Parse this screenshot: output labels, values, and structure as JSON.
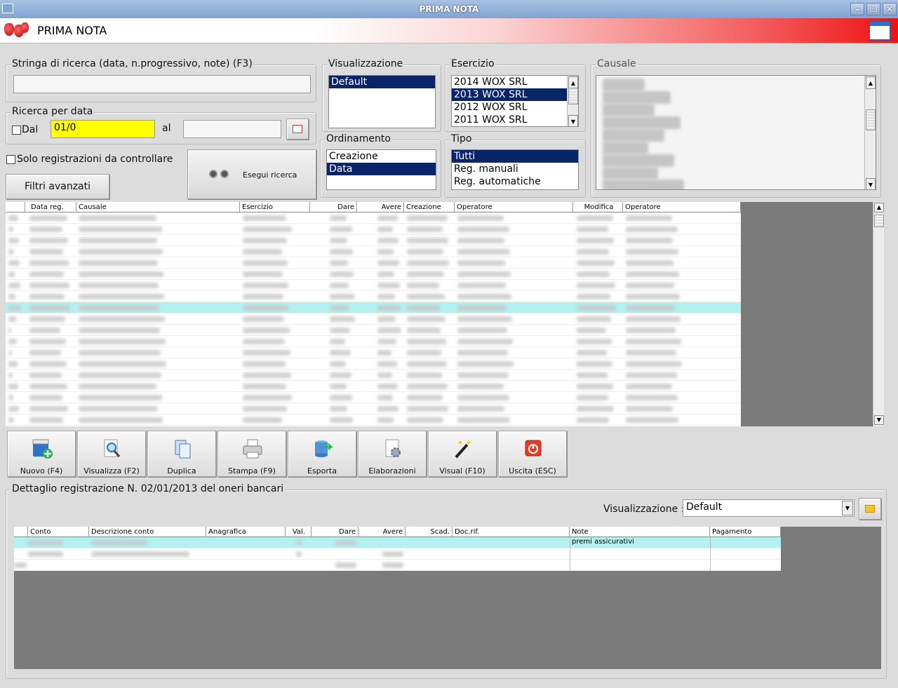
{
  "window": {
    "title": "PRIMA NOTA",
    "min": "–",
    "max": "❐",
    "close": "✕"
  },
  "header": {
    "title": "PRIMA NOTA"
  },
  "search": {
    "string_label": "Stringa di ricerca (data, n.progressivo, note) (F3)",
    "string_value": "",
    "date_group_label": "Ricerca per data",
    "dal_label": "Dal",
    "dal_value": "01/0",
    "al_label": "al",
    "al_value": "",
    "solo_label": "Solo registrazioni da controllare",
    "filtri_label": "Filtri avanzati",
    "esegui_label": "Esegui ricerca"
  },
  "visualizzazione": {
    "label": "Visualizzazione",
    "items": [
      "Default"
    ]
  },
  "ordinamento": {
    "label": "Ordinamento",
    "items": [
      "Creazione",
      "Data"
    ]
  },
  "esercizio": {
    "label": "Esercizio",
    "items": [
      "2014 WOX SRL",
      "2013 WOX SRL",
      "2012 WOX SRL",
      "2011 WOX SRL"
    ]
  },
  "tipo": {
    "label": "Tipo",
    "items": [
      "Tutti",
      "Reg. manuali",
      "Reg. automatiche"
    ]
  },
  "causale": {
    "label": "Causale"
  },
  "main_grid": {
    "columns": [
      "Data reg.",
      "Causale",
      "Esercizio",
      "Dare",
      "Avere",
      "Creazione",
      "Operatore",
      "Modifica",
      "Operatore"
    ]
  },
  "toolbar": {
    "items": [
      {
        "label": "Nuovo (F4)"
      },
      {
        "label": "Visualizza (F2)"
      },
      {
        "label": "Duplica"
      },
      {
        "label": "Stampa (F9)"
      },
      {
        "label": "Esporta"
      },
      {
        "label": "Elaborazioni"
      },
      {
        "label": "Visual (F10)"
      },
      {
        "label": "Uscita (ESC)"
      }
    ]
  },
  "detail": {
    "title": "Dettaglio registrazione N. 02/01/2013 del oneri bancari",
    "vis_label": "Visualizzazione :",
    "vis_value": "Default",
    "columns": [
      "Conto",
      "Descrizione conto",
      "Anagrafica",
      "Val.",
      "Dare",
      "Avere",
      "Scad.",
      "Doc.rif.",
      "Note",
      "Pagamento"
    ],
    "note_row1": "premi assicurativi"
  },
  "colors": {
    "selection": "#0a246a",
    "highlight": "#b3f0f0",
    "date_field": "#ffff00"
  }
}
